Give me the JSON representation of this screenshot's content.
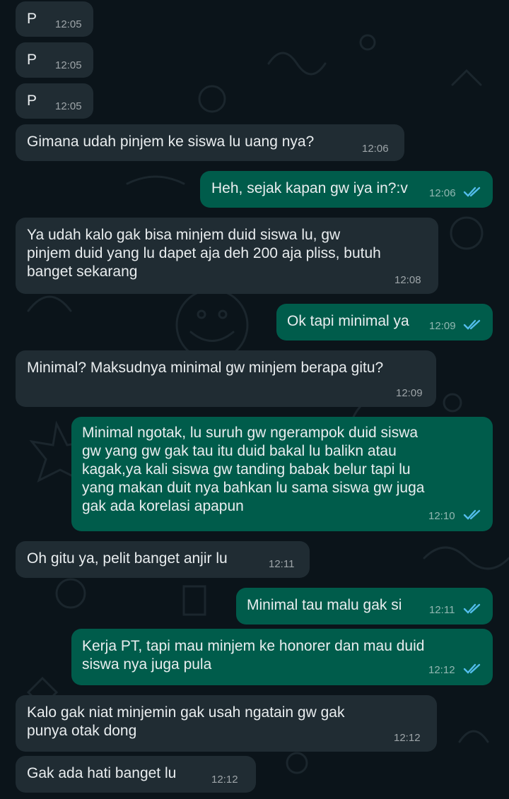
{
  "colors": {
    "background": "#0b141a",
    "incoming_bubble": "#202c33",
    "outgoing_bubble": "#005c4b",
    "text": "#e9edef",
    "read_ticks": "#53bdeb"
  },
  "messages": [
    {
      "direction": "incoming",
      "text": "P",
      "time": "12:05"
    },
    {
      "direction": "incoming",
      "text": "P",
      "time": "12:05"
    },
    {
      "direction": "incoming",
      "text": "P",
      "time": "12:05"
    },
    {
      "direction": "incoming",
      "text": "Gimana udah pinjem ke siswa lu uang nya?",
      "time": "12:06"
    },
    {
      "direction": "outgoing",
      "text": "Heh, sejak kapan gw iya in?:v",
      "time": "12:06",
      "status": "read-double-check-icon"
    },
    {
      "direction": "incoming",
      "text": "Ya udah kalo gak bisa minjem duid siswa lu, gw\npinjem duid yang lu dapet aja deh 200 aja pliss, butuh\nbanget sekarang",
      "time": "12:08"
    },
    {
      "direction": "outgoing",
      "text": "Ok tapi minimal ya",
      "time": "12:09",
      "status": "read-double-check-icon"
    },
    {
      "direction": "incoming",
      "text": "Minimal? Maksudnya minimal gw minjem berapa gitu?",
      "time": "12:09"
    },
    {
      "direction": "outgoing",
      "text": "Minimal ngotak, lu suruh gw ngerampok duid siswa\ngw yang gw gak tau itu duid bakal lu balikn atau\nkagak,ya kali siswa gw tanding babak belur tapi lu\nyang makan duit nya bahkan lu sama siswa gw juga\ngak ada korelasi apapun",
      "time": "12:10",
      "status": "read-double-check-icon"
    },
    {
      "direction": "incoming",
      "text": "Oh gitu ya, pelit banget anjir lu",
      "time": "12:11"
    },
    {
      "direction": "outgoing",
      "text": "Minimal tau malu gak si",
      "time": "12:11",
      "status": "read-double-check-icon"
    },
    {
      "direction": "outgoing",
      "text": "Kerja PT, tapi mau minjem ke honorer dan mau duid\nsiswa nya juga pula",
      "time": "12:12",
      "status": "read-double-check-icon"
    },
    {
      "direction": "incoming",
      "text": "Kalo gak niat minjemin gak usah ngatain gw gak\npunya otak dong",
      "time": "12:12"
    },
    {
      "direction": "incoming",
      "text": "Gak ada hati banget lu",
      "time": "12:12"
    }
  ]
}
